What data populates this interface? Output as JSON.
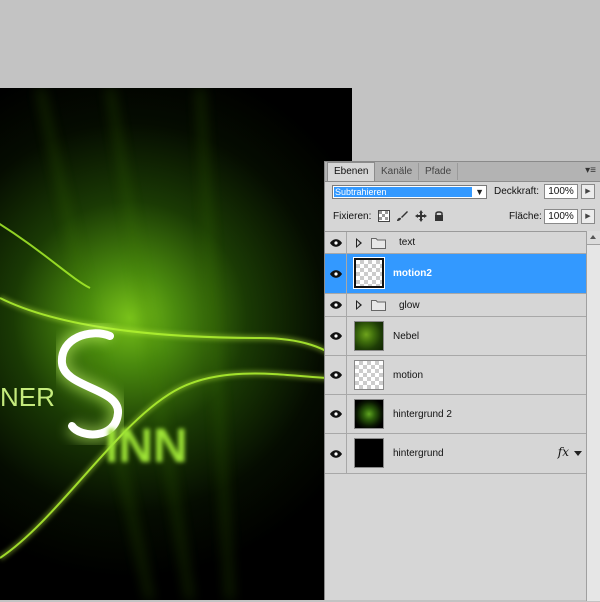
{
  "canvas": {
    "artwork_text": "NER",
    "artwork_text2": "INN"
  },
  "panel": {
    "tabs": [
      {
        "label": "Ebenen",
        "active": true
      },
      {
        "label": "Kanäle",
        "active": false
      },
      {
        "label": "Pfade",
        "active": false
      }
    ],
    "menu_glyph": "▾≡",
    "blend_mode": "Subtrahieren",
    "opacity_label": "Deckkraft:",
    "opacity_value": "100%",
    "lock_label": "Fixieren:",
    "fill_label": "Fläche:",
    "fill_value": "100%"
  },
  "layers": [
    {
      "name": "text",
      "type": "group",
      "selected": false,
      "visible": true
    },
    {
      "name": "motion2",
      "type": "layer",
      "thumb": "transparent",
      "selected": true,
      "visible": true
    },
    {
      "name": "glow",
      "type": "group",
      "selected": false,
      "visible": true
    },
    {
      "name": "Nebel",
      "type": "layer",
      "thumb": "nebel",
      "selected": false,
      "visible": true
    },
    {
      "name": "motion",
      "type": "layer",
      "thumb": "transparent",
      "selected": false,
      "visible": true
    },
    {
      "name": "hintergrund 2",
      "type": "layer",
      "thumb": "radial-green",
      "selected": false,
      "visible": true
    },
    {
      "name": "hintergrund",
      "type": "layer",
      "thumb": "black",
      "selected": false,
      "visible": true,
      "fx": "fx"
    }
  ],
  "colors": {
    "selection": "#3399ff",
    "glow_green": "#8ee81a"
  }
}
